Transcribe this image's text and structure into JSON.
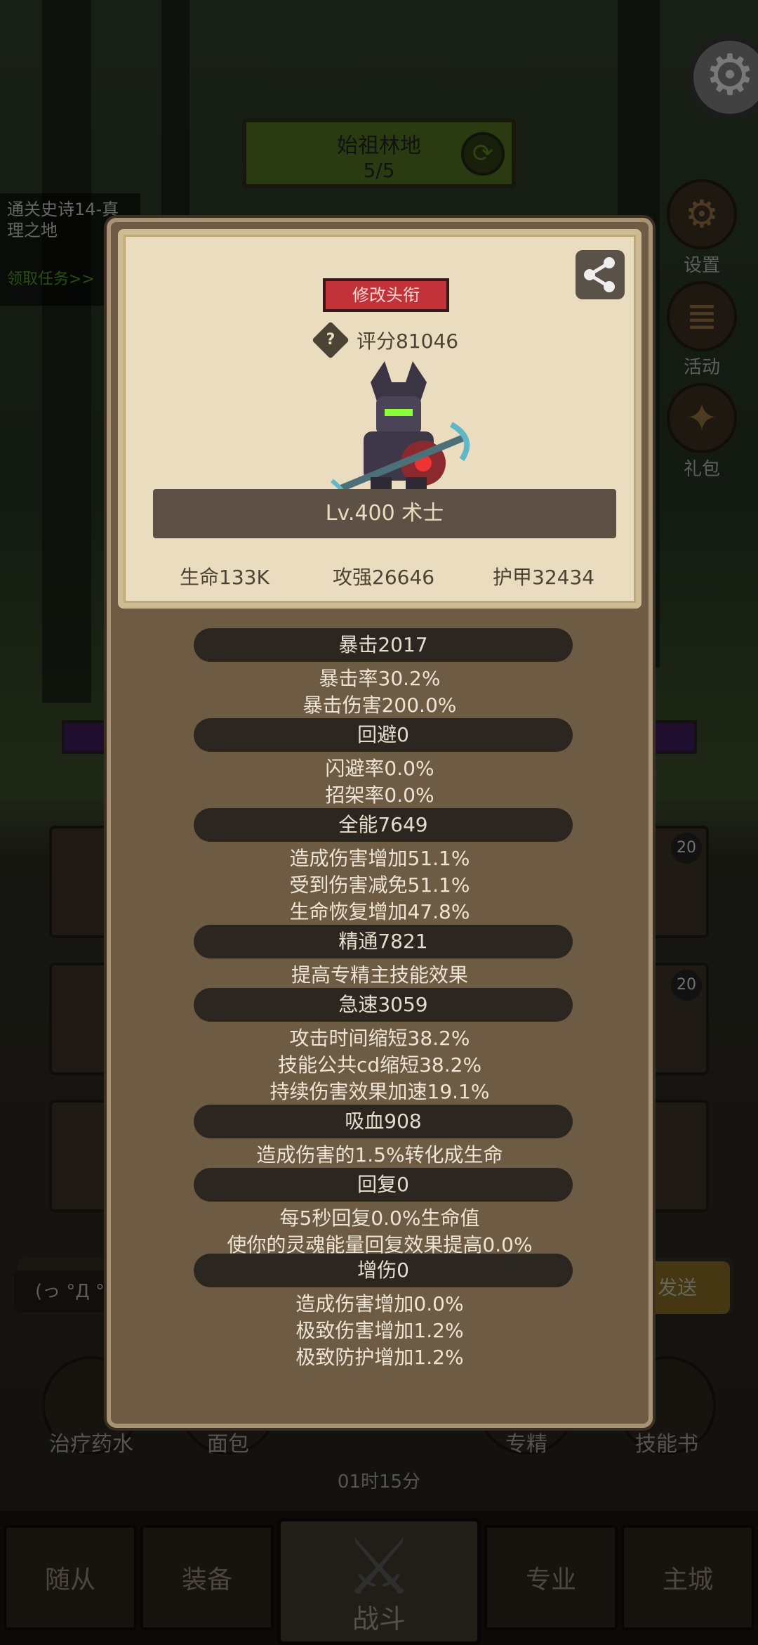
{
  "scene": {
    "map_name": "始祖林地",
    "map_progress": "5/5",
    "quest_text": "通关史诗14-真理之地",
    "quest_link": "领取任务>>",
    "side_buttons": [
      {
        "label": "设置",
        "icon": "gear-icon"
      },
      {
        "label": "活动",
        "icon": "scroll-icon"
      },
      {
        "label": "礼包",
        "icon": "gift-icon"
      }
    ],
    "slot_counts": [
      "20",
      "20"
    ],
    "chat_placeholder": "(っ °Д °",
    "chat_send": "发送",
    "items": [
      "治疗药水",
      "面包",
      "专精",
      "技能书"
    ],
    "timer": "01时15分",
    "nav": {
      "tab1": "随从",
      "tab2": "装备",
      "battle": "战斗",
      "tab4": "专业",
      "tab5": "主城"
    }
  },
  "profile": {
    "title_button": "修改头衔",
    "score": "评分81046",
    "help_symbol": "?",
    "level_class": "Lv.400 术士",
    "hp": "生命133K",
    "attack": "攻强26646",
    "armor": "护甲32434"
  },
  "attributes": {
    "crit": {
      "header": "暴击2017",
      "lines": [
        "暴击率30.2%",
        "暴击伤害200.0%"
      ]
    },
    "dodge": {
      "header": "回避0",
      "lines": [
        "闪避率0.0%",
        "招架率0.0%"
      ]
    },
    "versatility": {
      "header": "全能7649",
      "lines": [
        "造成伤害增加51.1%",
        "受到伤害减免51.1%",
        "生命恢复增加47.8%"
      ]
    },
    "mastery": {
      "header": "精通7821",
      "lines": [
        "提高专精主技能效果"
      ]
    },
    "haste": {
      "header": "急速3059",
      "lines": [
        "攻击时间缩短38.2%",
        "技能公共cd缩短38.2%",
        "持续伤害效果加速19.1%"
      ]
    },
    "leech": {
      "header": "吸血908",
      "lines": [
        "造成伤害的1.5%转化成生命"
      ]
    },
    "regen": {
      "header": "回复0",
      "lines": [
        "每5秒回复0.0%生命值",
        "使你的灵魂能量回复效果提高0.0%"
      ]
    },
    "damage": {
      "header": "增伤0",
      "lines": [
        "造成伤害增加0.0%",
        "极致伤害增加1.2%",
        "极致防护增加1.2%"
      ]
    }
  }
}
